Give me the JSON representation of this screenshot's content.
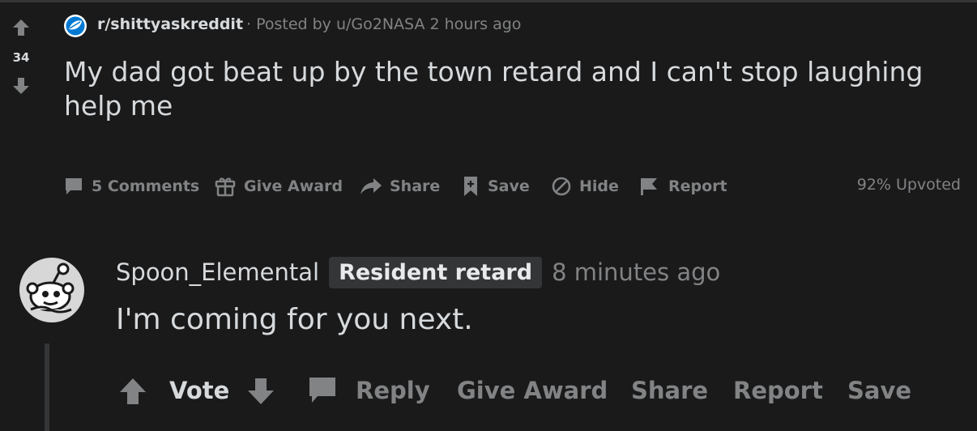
{
  "post": {
    "score": "34",
    "subreddit": "r/shittyaskreddit",
    "separator": "·",
    "posted_by": "Posted by u/Go2NASA 2 hours ago",
    "title": "My dad got beat up by the town retard and I can't stop laughing help me",
    "actions": {
      "comments": "5 Comments",
      "give_award": "Give Award",
      "share": "Share",
      "save": "Save",
      "hide": "Hide",
      "report": "Report"
    },
    "upvoted": "92% Upvoted"
  },
  "comment": {
    "author": "Spoon_Elemental",
    "flair": "Resident retard",
    "time": "8 minutes ago",
    "body": "I'm coming for you next.",
    "actions": {
      "vote": "Vote",
      "reply": "Reply",
      "give_award": "Give Award",
      "share": "Share",
      "report": "Report",
      "save": "Save"
    }
  },
  "colors": {
    "background": "#1a1a1b",
    "text": "#d7dadc",
    "muted": "#818384",
    "flair_bg": "#343536",
    "subreddit_icon": "#0079d3"
  },
  "icons": [
    "upvote-icon",
    "downvote-icon",
    "subreddit-icon",
    "comment-icon",
    "gift-icon",
    "share-arrow-icon",
    "bookmark-icon",
    "hide-icon",
    "flag-icon",
    "snoo-avatar-icon"
  ]
}
